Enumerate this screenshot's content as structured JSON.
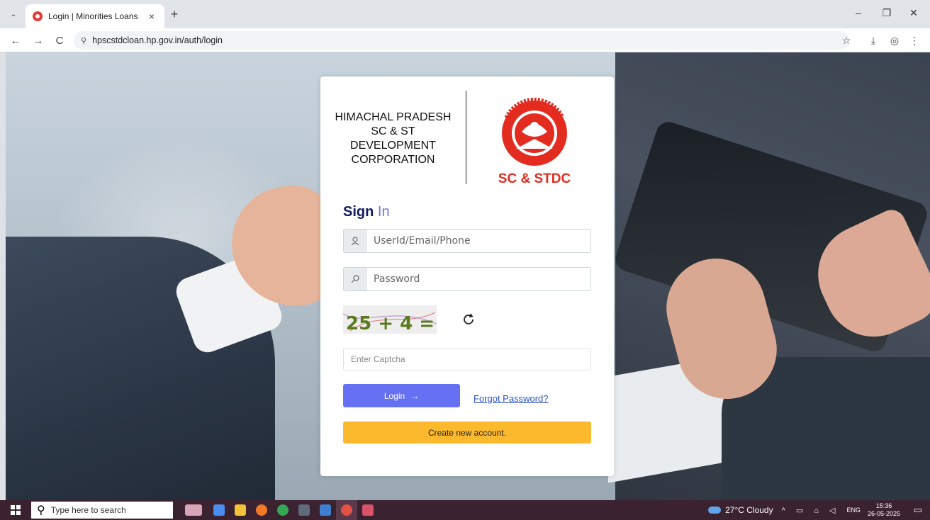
{
  "browser": {
    "tab_title": "Login | Minorities Loans",
    "tab_close": "×",
    "new_tab": "+",
    "url": "hpscstdcloan.hp.gov.in/auth/login",
    "back": "←",
    "forward": "→",
    "reload": "C",
    "minimize": "–",
    "restore": "❐",
    "close": "✕",
    "tab_menu": "⌄"
  },
  "org": {
    "name": "HIMACHAL PRADESH SC & ST DEVELOPMENT CORPORATION",
    "logo_text": "SC & STDC"
  },
  "login": {
    "heading_bold": "Sign",
    "heading_light": "In",
    "user_placeholder": "UserId/Email/Phone",
    "password_placeholder": "Password",
    "captcha_placeholder": "Enter Captcha",
    "captcha_text": "25 + 4 =",
    "login_label": "Login",
    "forgot_label": "Forgot Password?",
    "create_label": "Create new account."
  },
  "taskbar": {
    "search_placeholder": "Type here to search",
    "weather": "27°C  Cloudy",
    "lang": "ENG",
    "time": "15:36",
    "date": "26-05-2025"
  },
  "colors": {
    "primary": "#6571f2",
    "warning": "#fcb92e",
    "heading": "#0f1b5f",
    "logo_red": "#e32b1f"
  }
}
